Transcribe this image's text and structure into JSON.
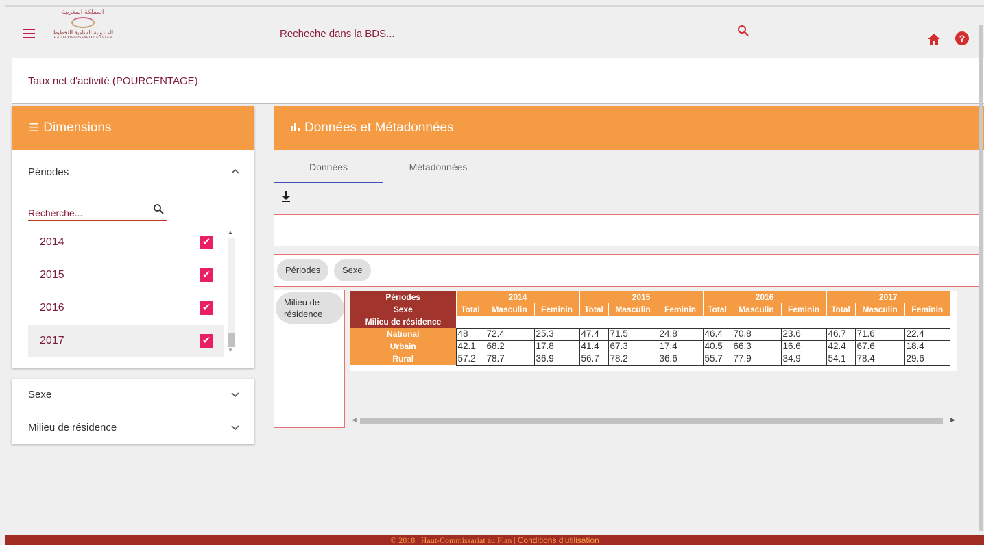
{
  "header": {
    "search_placeholder": "Recheche dans la BDS...",
    "logo": {
      "arabic_top": "المملكة المغربية",
      "arabic_bottom": "المندوبية السامية للتخطيط",
      "french": "HAUT-COMMISSARIAT AU PLAN"
    },
    "help_label": "?"
  },
  "page_title": "Taux net d'activité (POURCENTAGE)",
  "dimensions": {
    "title": "Dimensions",
    "periodes_label": "Périodes",
    "search_placeholder": "Recherche...",
    "years": [
      "2014",
      "2015",
      "2016",
      "2017"
    ],
    "checked": [
      true,
      true,
      true,
      true
    ],
    "other": [
      "Sexe",
      "Milieu de résidence"
    ]
  },
  "data_panel": {
    "title": "Données et Métadonnées",
    "tabs": [
      "Données",
      "Métadonnées"
    ],
    "active_tab": "Données",
    "column_chips": [
      "Périodes",
      "Sexe"
    ],
    "row_chip": "Milieu de résidence"
  },
  "pivot": {
    "periodes_label": "Périodes",
    "sexe_label": "Sexe",
    "milieu_label": "Milieu de résidence",
    "years": [
      "2014",
      "2015",
      "2016",
      "2017"
    ],
    "sexes": [
      "Total",
      "Masculin",
      "Feminin"
    ],
    "rows": [
      {
        "label": "National",
        "values": [
          "48",
          "72.4",
          "25.3",
          "47.4",
          "71.5",
          "24.8",
          "46.4",
          "70.8",
          "23.6",
          "46.7",
          "71.6",
          "22.4"
        ]
      },
      {
        "label": "Urbain",
        "values": [
          "42.1",
          "68.2",
          "17.8",
          "41.4",
          "67.3",
          "17.4",
          "40.5",
          "66.3",
          "16.6",
          "42.4",
          "67.6",
          "18.4"
        ]
      },
      {
        "label": "Rural",
        "values": [
          "57.2",
          "78.7",
          "36.9",
          "56.7",
          "78.2",
          "36.6",
          "55.7",
          "77.9",
          "34.9",
          "54.1",
          "78.4",
          "29.6"
        ]
      }
    ]
  },
  "footer": {
    "text": "© 2018 | Haut-Commissariat au Plan | ",
    "link": "Conditions d'utilisation"
  },
  "colors": {
    "accent_orange": "#f49b44",
    "dark_red": "#a1342d",
    "pink_check": "#e91e63",
    "title_text": "#7a1b3b"
  }
}
